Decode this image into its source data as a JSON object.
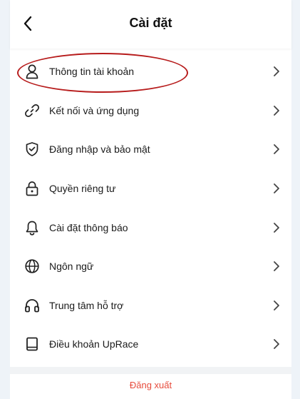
{
  "header": {
    "title": "Cài đặt",
    "back_icon": "chevron-left-icon"
  },
  "menu": {
    "items": [
      {
        "label": "Thông tin tài khoản",
        "icon": "user-icon"
      },
      {
        "label": "Kết nối và ứng dụng",
        "icon": "link-icon"
      },
      {
        "label": "Đăng nhập và bảo mật",
        "icon": "shield-icon"
      },
      {
        "label": "Quyền riêng tư",
        "icon": "lock-icon"
      },
      {
        "label": "Cài đặt thông báo",
        "icon": "bell-icon"
      },
      {
        "label": "Ngôn ngữ",
        "icon": "globe-icon"
      },
      {
        "label": "Trung tâm hỗ trợ",
        "icon": "headphones-icon"
      },
      {
        "label": "Điều khoản UpRace",
        "icon": "book-icon"
      }
    ],
    "chevron_icon": "chevron-right-icon"
  },
  "footer": {
    "logout_label": "Đăng xuất"
  },
  "colors": {
    "page_background": "#eef3f8",
    "card_background": "#ffffff",
    "logout": "#e74b3c",
    "highlight": "#b71c1c",
    "text": "#1a1a1a"
  }
}
